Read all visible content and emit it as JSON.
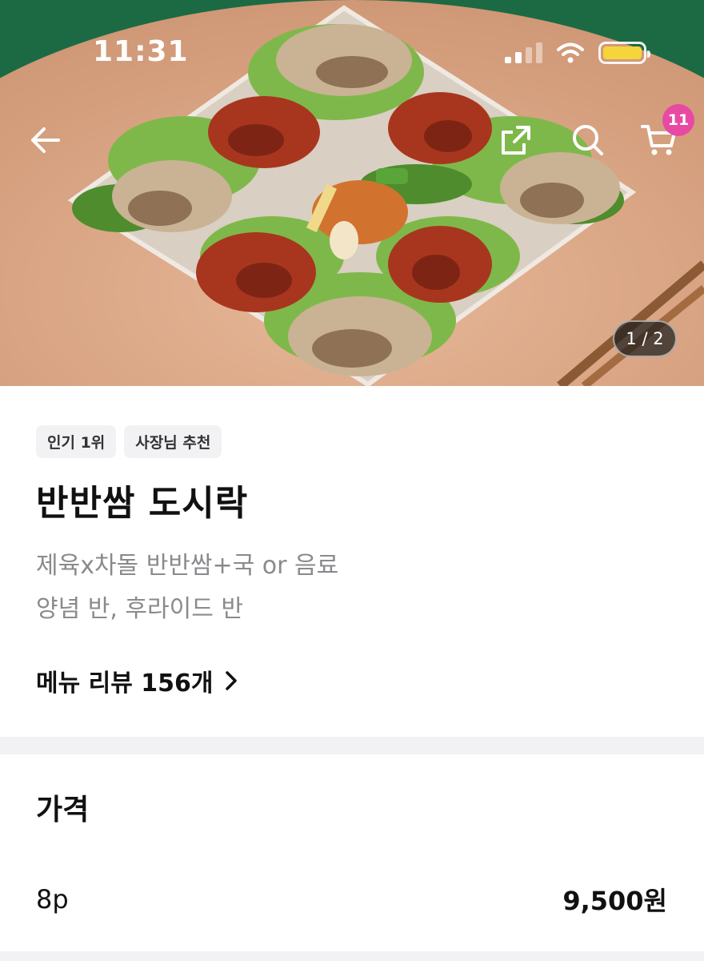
{
  "status_bar": {
    "time": "11:31",
    "battery_color": "#f6d43b"
  },
  "header": {
    "back_icon": "arrow-left-icon",
    "share_icon": "share-icon",
    "search_icon": "search-icon",
    "cart_icon": "cart-icon",
    "cart_count": "11",
    "badge_color": "#e84aa3"
  },
  "gallery": {
    "indicator": "1 / 2"
  },
  "product": {
    "tags": [
      "인기 1위",
      "사장님 추천"
    ],
    "name": "반반쌈 도시락",
    "description_line1": "제육x차돌 반반쌈+국 or 음료",
    "description_line2": "양념 반, 후라이드 반",
    "reviews_label": "메뉴 리뷰 156개"
  },
  "price": {
    "section_title": "가격",
    "option": "8p",
    "value": "9,500원"
  }
}
